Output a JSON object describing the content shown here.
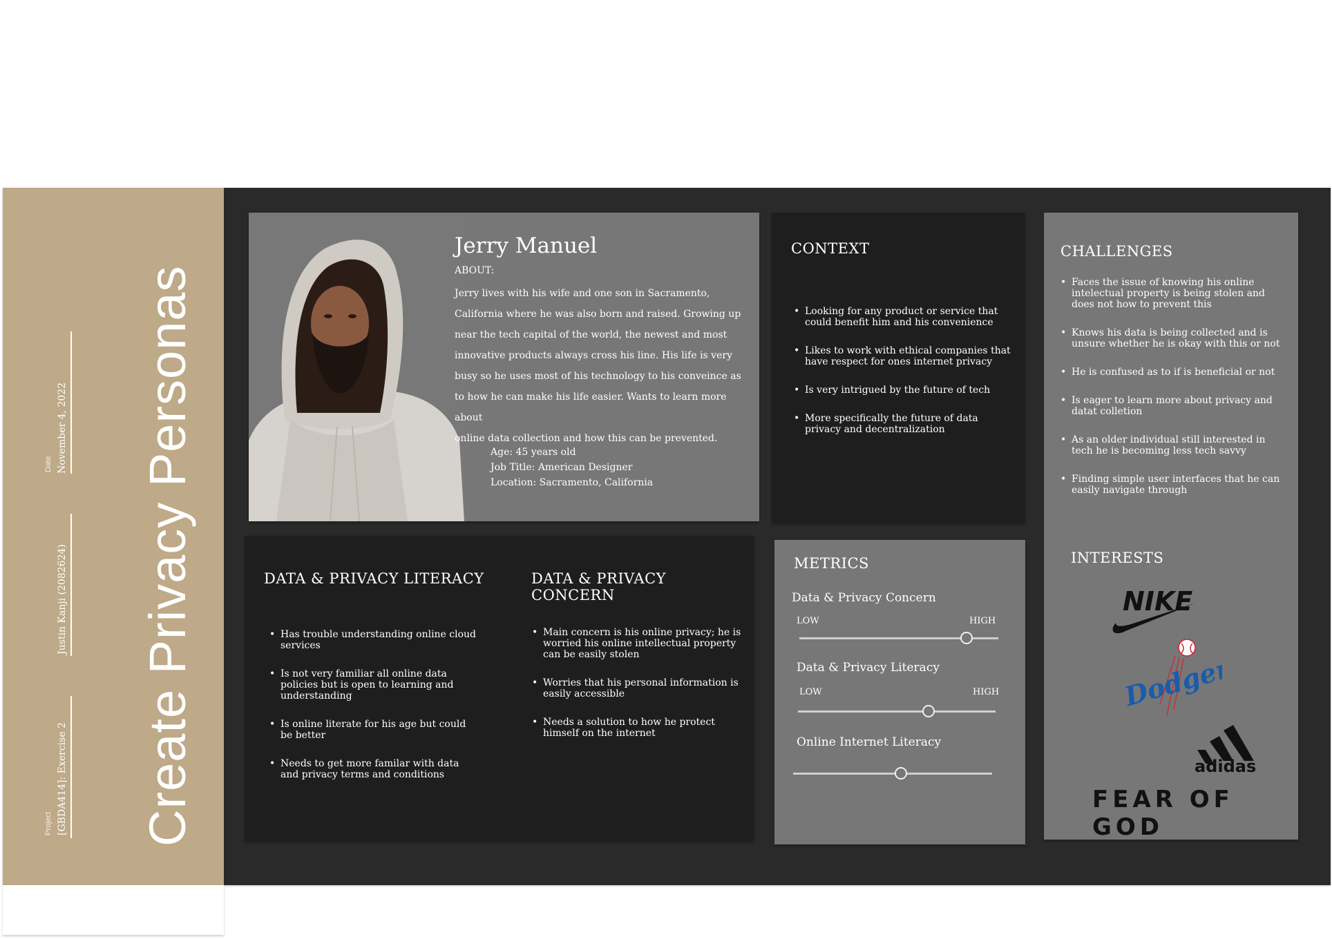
{
  "sidebar": {
    "title": "Create Privacy Personas",
    "date_label": "Date",
    "date_value": "November 4, 2022",
    "author_value": "Justin Kanji (2082624)",
    "project_label": "Project",
    "project_value": "[GBDA414]: Exercise 2"
  },
  "profile": {
    "name": "Jerry Manuel",
    "about_heading": "ABOUT:",
    "about_lines": [
      "Jerry lives with his wife and one son in Sacramento,",
      "California where he was also born and raised. Growing up",
      "near the tech capital of the world, the newest and most",
      "innovative products always cross his line. His life is very",
      "busy so he uses most of his technology to his conveince as",
      "to how he can make his life easier. Wants to learn more about",
      "online data collection and how this can be prevented."
    ],
    "age": "Age: 45 years old",
    "job": "Job Title: American Designer",
    "location": "Location: Sacramento, California"
  },
  "context": {
    "heading": "CONTEXT",
    "items": [
      "Looking for any product or service that could benefit him and his convenience",
      "Likes to work with ethical companies that have respect for ones internet privacy",
      "Is very intrigued by the future of tech",
      "More specifically the future of data privacy and decentralization"
    ]
  },
  "challenges": {
    "heading": "CHALLENGES",
    "items": [
      "Faces the issue of knowing his online intelectual property is being stolen and does not how to prevent this",
      "Knows his data is being collected and is unsure whether he is okay with this or not",
      "He is confused as to if is beneficial or not",
      "Is eager to learn more about privacy and datat colletion",
      "As an older individual still interested in tech he is becoming less tech savvy",
      "Finding simple user interfaces that he can easily navigate through"
    ]
  },
  "literacy": {
    "heading": "DATA & PRIVACY LITERACY",
    "items": [
      "Has trouble understanding online cloud services",
      "Is not very familiar all online data policies but is open to learning and understanding",
      "Is online literate for his age but could be better",
      "Needs to get more familar with data and privacy terms and conditions"
    ]
  },
  "concern": {
    "heading": "DATA & PRIVACY CONCERN",
    "items": [
      "Main concern is his online privacy; he is worried his online intellectual property can be easily stolen",
      "Worries that his personal information is easily accessible",
      "Needs a solution to how he protect himself on the internet"
    ]
  },
  "metrics": {
    "heading": "METRICS",
    "low": "LOW",
    "high": "HIGH",
    "sliders": [
      {
        "label": "Data & Privacy Concern",
        "value": 0.84
      },
      {
        "label": "Data & Privacy Literacy",
        "value": 0.66
      },
      {
        "label": "Online Internet Literacy",
        "value": 0.54
      }
    ]
  },
  "interests": {
    "heading": "INTERESTS",
    "brands": [
      "NIKE",
      "Dodgers",
      "adidas",
      "FEAR OF GOD"
    ]
  },
  "colors": {
    "sidebar": "#bea988",
    "board": "#2a2a2a",
    "card_grey": "#777777",
    "card_dark": "#1e1e1e",
    "dodgers_blue": "#1a5bab",
    "baseball_red": "#d0232b"
  }
}
